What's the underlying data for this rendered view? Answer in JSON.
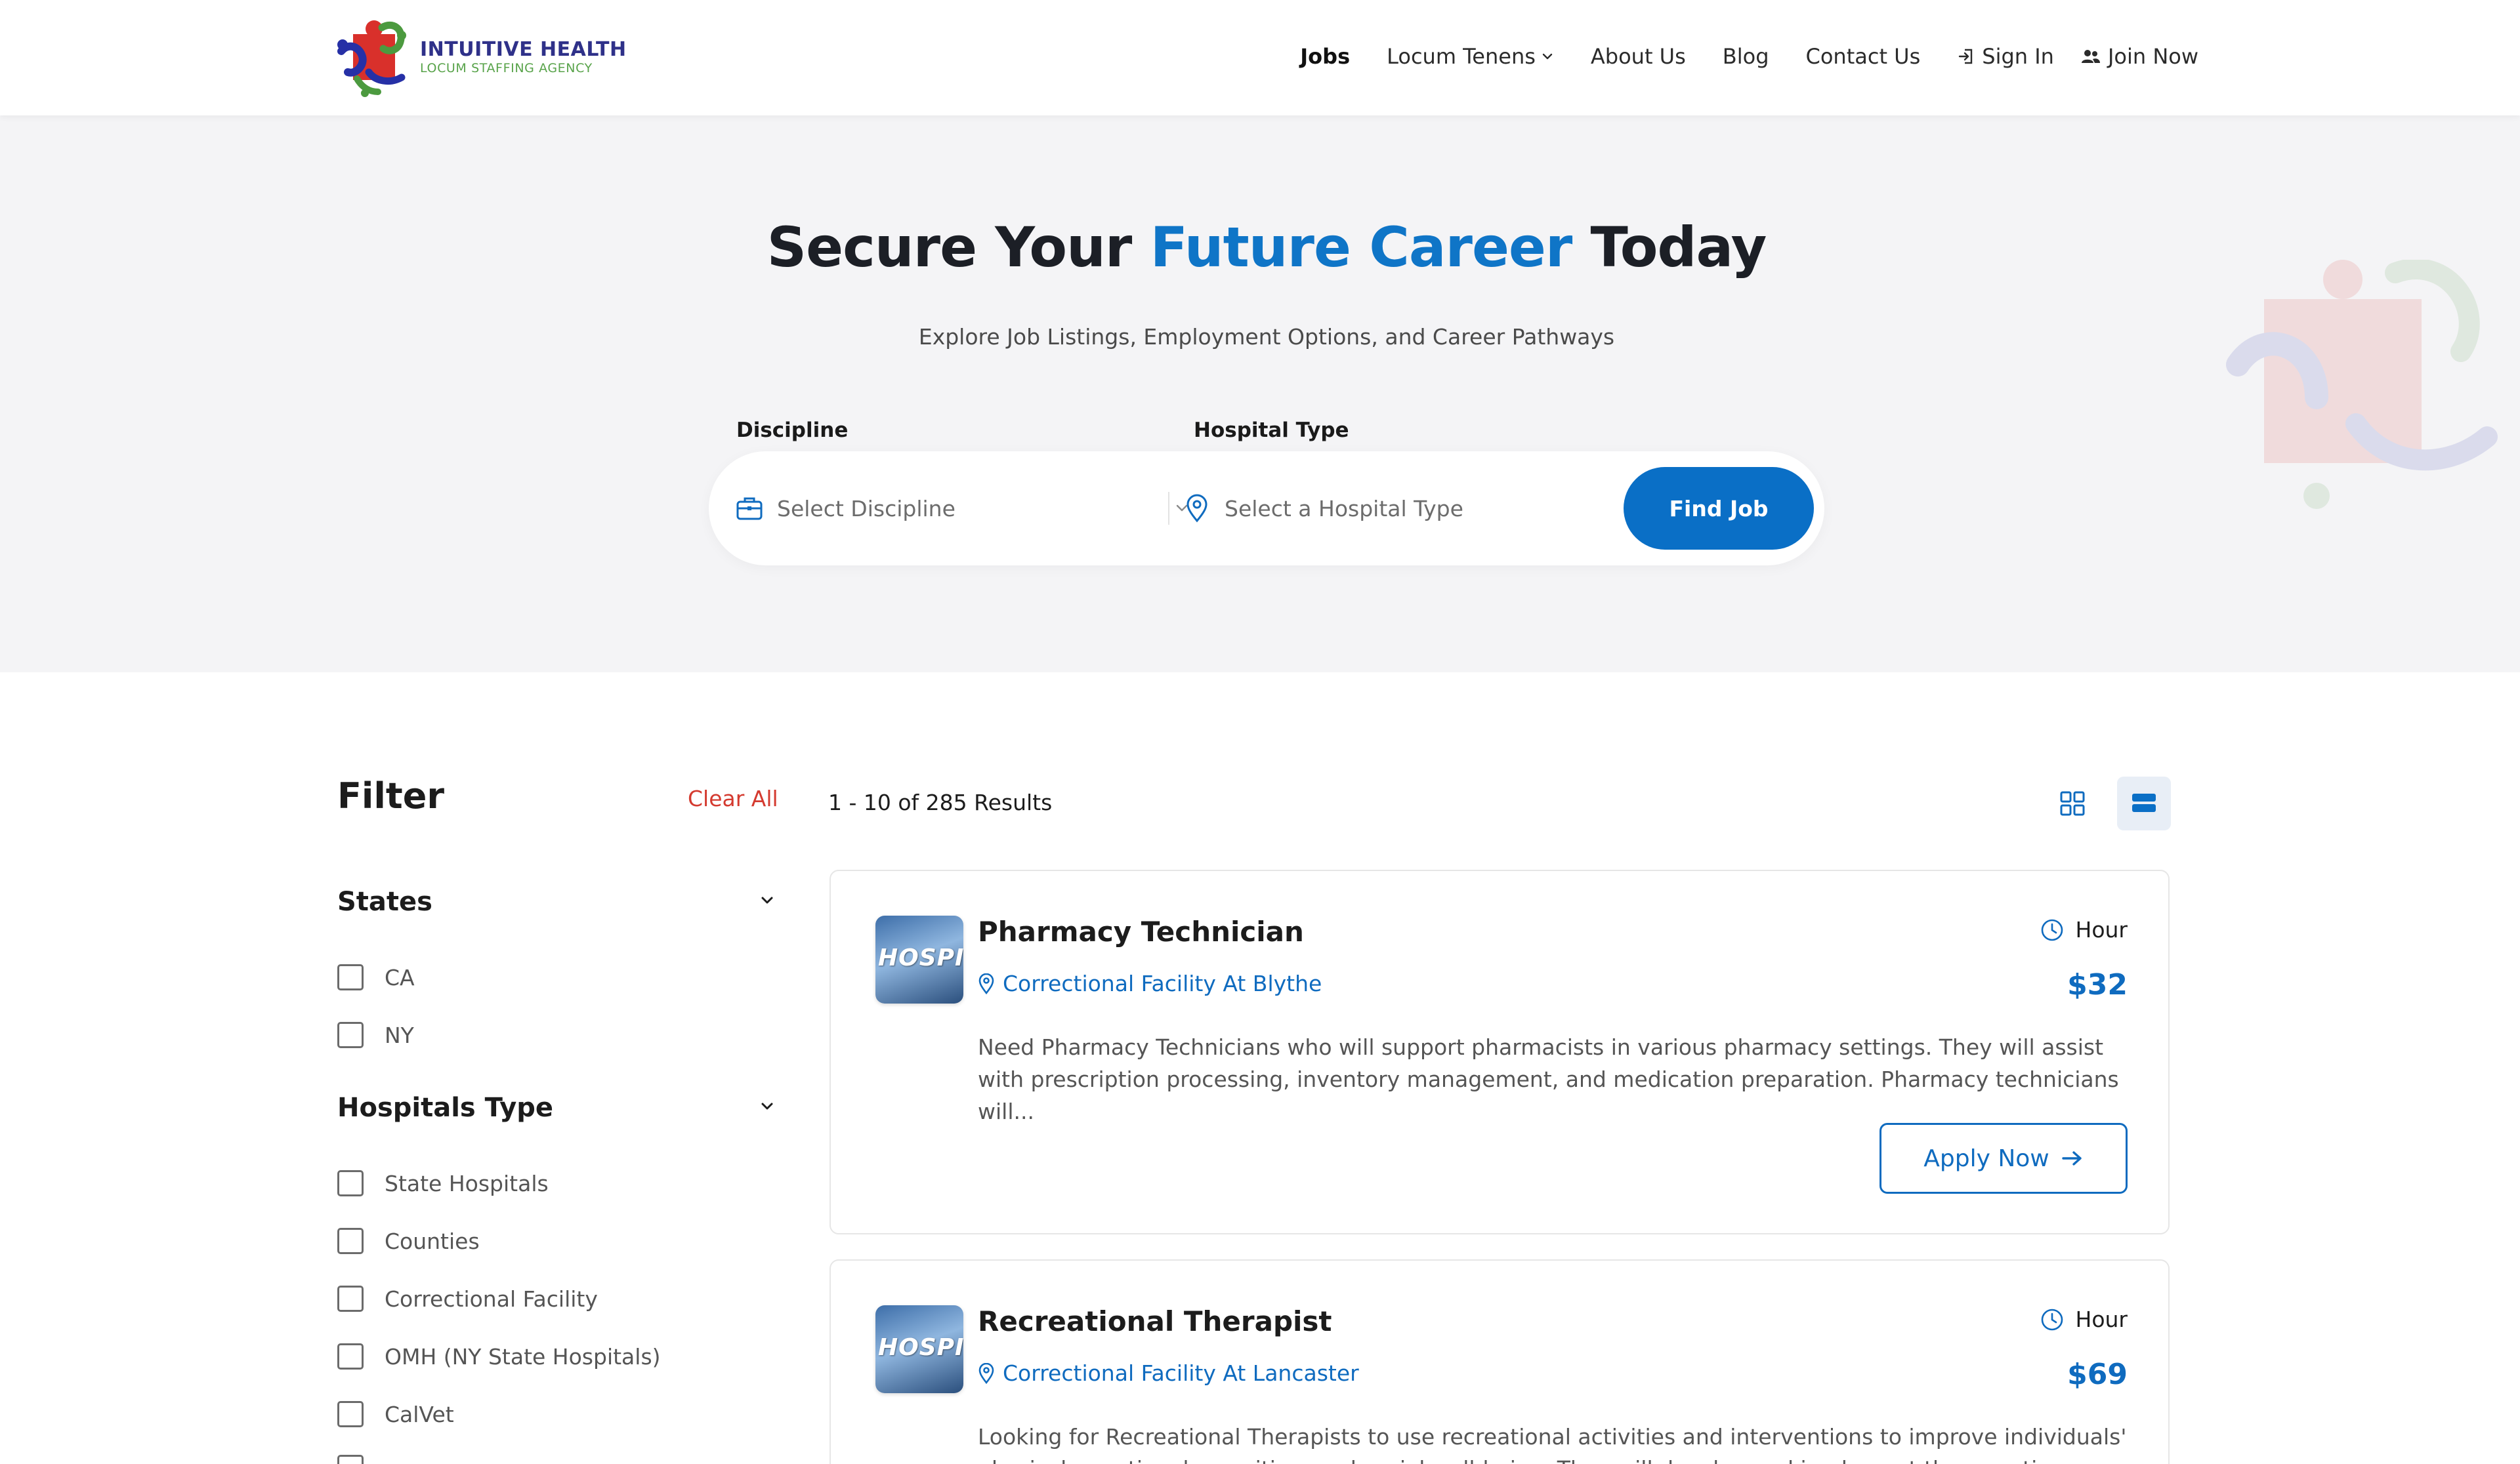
{
  "brand": {
    "name": "INTUITIVE HEALTH",
    "tagline": "LOCUM STAFFING AGENCY"
  },
  "nav": {
    "items": [
      {
        "label": "Jobs",
        "active": true
      },
      {
        "label": "Locum Tenens",
        "dropdown": true
      },
      {
        "label": "About Us"
      },
      {
        "label": "Blog"
      },
      {
        "label": "Contact Us"
      }
    ],
    "sign_in": "Sign In",
    "join_now": "Join Now"
  },
  "hero": {
    "title_part1": "Secure Your ",
    "title_accent": "Future Career",
    "title_part2": " Today",
    "subtitle": "Explore Job Listings, Employment Options, and Career Pathways",
    "accent_color": "#0f75c7"
  },
  "search": {
    "discipline_label": "Discipline",
    "discipline_placeholder": "Select Discipline",
    "hospital_label": "Hospital Type",
    "hospital_placeholder": "Select a Hospital Type",
    "button": "Find Job"
  },
  "filter": {
    "title": "Filter",
    "clear_all": "Clear All",
    "groups": [
      {
        "title": "States",
        "options": [
          "CA",
          "NY"
        ]
      },
      {
        "title": "Hospitals Type",
        "options": [
          "State Hospitals",
          "Counties",
          "Correctional Facility",
          "OMH (NY State Hospitals)",
          "CalVet"
        ]
      }
    ]
  },
  "results": {
    "count_text": "1 - 10 of 285 Results",
    "view_mode": "list"
  },
  "jobs": [
    {
      "thumb_text": "HOSPITA",
      "title": "Pharmacy Technician",
      "location": "Correctional Facility At Blythe",
      "period": "Hour",
      "rate": "$32",
      "description": "Need Pharmacy Technicians who will support pharmacists in various pharmacy settings. They will assist with prescription processing, inventory management, and medication preparation. Pharmacy technicians will...",
      "apply": "Apply Now"
    },
    {
      "thumb_text": "HOSPITA",
      "title": "Recreational Therapist",
      "location": "Correctional Facility At Lancaster",
      "period": "Hour",
      "rate": "$69",
      "description": "Looking for Recreational Therapists to use recreational activities and interventions to improve individuals' physical, emotional, cognitive, and social well-being. They will develop and implement therapeutic..."
    }
  ],
  "colors": {
    "primary": "#0a6fc6",
    "link": "#0f6bbf",
    "danger": "#d43a2f",
    "hero_bg": "#f4f4f6"
  }
}
